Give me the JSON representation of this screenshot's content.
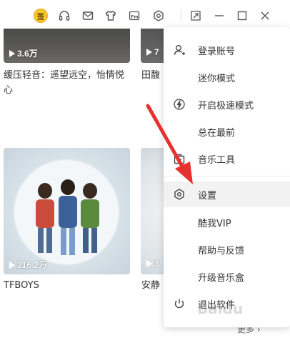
{
  "titlebar": {
    "vip_coin_text": "签",
    "icons": [
      "vip-coin-icon",
      "headphones-icon",
      "mail-icon",
      "tshirt-icon",
      "fm-icon",
      "settings-hexagon-icon",
      "mini-mode-icon",
      "minimize-icon",
      "maximize-icon",
      "close-icon"
    ]
  },
  "cards": [
    {
      "title": "缓压轻音：遥望远空，怡情悦心",
      "plays": "3.6万"
    },
    {
      "title": "田馥",
      "plays": "7"
    },
    {
      "title": "TFBOYS",
      "plays": "216.2万"
    },
    {
      "title": "安静",
      "plays": "3"
    }
  ],
  "menu": {
    "items": [
      {
        "label": "登录账号",
        "icon": "user-icon"
      },
      {
        "label": "迷你模式",
        "icon": ""
      },
      {
        "label": "开启极速模式",
        "icon": "lightning-icon"
      },
      {
        "label": "总在最前",
        "icon": ""
      },
      {
        "label": "音乐工具",
        "icon": "toolbox-icon"
      },
      {
        "label": "设置",
        "icon": "settings-hexagon-icon",
        "active": true
      },
      {
        "label": "酷我VIP",
        "icon": ""
      },
      {
        "label": "帮助与反馈",
        "icon": ""
      },
      {
        "label": "升级音乐盒",
        "icon": ""
      },
      {
        "label": "退出软件",
        "icon": "power-icon"
      }
    ]
  },
  "more_link": "更多 ›",
  "watermark": "Baidu",
  "colors": {
    "accent_arrow": "#e8312e",
    "vip_coin": "#f7c52e",
    "menu_active_bg": "#f2f2f2"
  }
}
